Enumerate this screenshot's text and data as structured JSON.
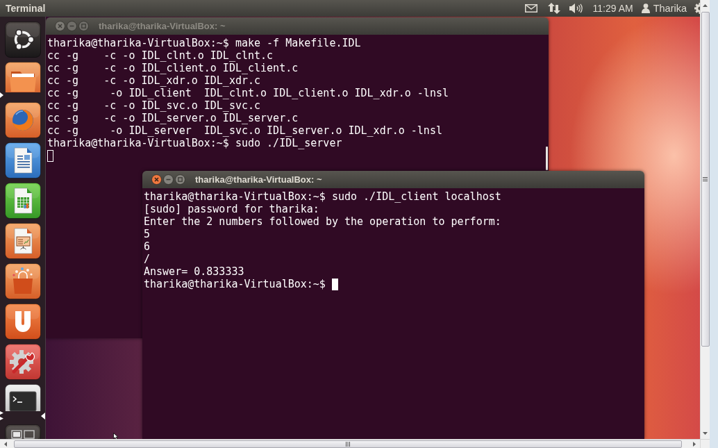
{
  "top_panel": {
    "app_title": "Terminal",
    "clock": "11:29 AM",
    "user": "Tharika"
  },
  "launcher": {
    "items": [
      {
        "kind": "dash",
        "running": false,
        "active": false
      },
      {
        "kind": "files",
        "running": true,
        "multiple_windows": false,
        "active": false
      },
      {
        "kind": "browser",
        "running": false,
        "active": false
      },
      {
        "kind": "writer",
        "running": false,
        "active": false
      },
      {
        "kind": "calc",
        "running": false,
        "active": false
      },
      {
        "kind": "impress",
        "running": false,
        "active": false
      },
      {
        "kind": "software_center",
        "running": false,
        "active": false
      },
      {
        "kind": "ubuntu_one",
        "running": false,
        "active": false
      },
      {
        "kind": "settings",
        "running": false,
        "active": false
      },
      {
        "kind": "terminal",
        "running": true,
        "multiple_windows": true,
        "active": true
      },
      {
        "kind": "workspaces",
        "running": false,
        "active": false
      }
    ]
  },
  "windows": [
    {
      "title": "tharika@tharika-VirtualBox: ~",
      "focused": false,
      "lines": [
        "tharika@tharika-VirtualBox:~$ make -f Makefile.IDL",
        "cc -g    -c -o IDL_clnt.o IDL_clnt.c",
        "cc -g    -c -o IDL_client.o IDL_client.c",
        "cc -g    -c -o IDL_xdr.o IDL_xdr.c",
        "cc -g     -o IDL_client  IDL_clnt.o IDL_client.o IDL_xdr.o -lnsl",
        "cc -g    -c -o IDL_svc.o IDL_svc.c",
        "cc -g    -c -o IDL_server.o IDL_server.c",
        "cc -g     -o IDL_server  IDL_svc.o IDL_server.o IDL_xdr.o -lnsl",
        "tharika@tharika-VirtualBox:~$ sudo ./IDL_server"
      ]
    },
    {
      "title": "tharika@tharika-VirtualBox: ~",
      "focused": true,
      "lines": [
        "tharika@tharika-VirtualBox:~$ sudo ./IDL_client localhost",
        "[sudo] password for tharika:",
        "Enter the 2 numbers followed by the operation to perform:",
        "5",
        "6",
        "/",
        "Answer= 0.833333"
      ],
      "prompt": "tharika@tharika-VirtualBox:~$"
    }
  ]
}
